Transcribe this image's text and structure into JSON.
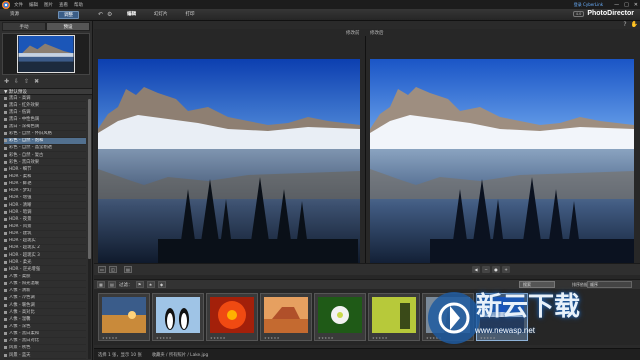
{
  "titlebar": {
    "menus": [
      "文件",
      "编辑",
      "图片",
      "查看",
      "帮助"
    ],
    "account": "登录 CyberLink",
    "controls": [
      "—",
      "□",
      "✕"
    ]
  },
  "modebar": {
    "left_tabs": [
      "资源",
      "调整"
    ],
    "modes": [
      "编辑",
      "幻灯片",
      "打印"
    ],
    "version": "4.0",
    "brand": "PhotoDirector"
  },
  "left_panel": {
    "subtabs": [
      "手动",
      "预设"
    ],
    "section_header": "▼ 默认预设",
    "presets": [
      "黑白 - 高调",
      "黑白 - 红外效果",
      "黑白 - 低调",
      "黑白 - 中性色调",
      "黑白 - 深褐色调",
      "彩色 - 自然 - 怀旧风格",
      "彩色 - 自然 - 饱和",
      "彩色 - 自然 - 晶莹剔透",
      "彩色 - 自然 - 复古",
      "彩色 - 黑白效果",
      "HDR - 细节",
      "HDR - 柔和",
      "HDR - 鲜艳",
      "HDR - 梦幻",
      "HDR - 增强",
      "HDR - 清晰",
      "HDR - 暗调",
      "HDR - 夜景",
      "HDR - 风景",
      "HDR - 建筑",
      "HDR - 超现实",
      "HDR - 超现实 2",
      "HDR - 超现实 3",
      "HDR - 柔光",
      "HDR - 逆光增强",
      "人像 - 柔肤",
      "人像 - 阳光温暖",
      "人像 - 清新",
      "人像 - 冷色调",
      "人像 - 暖色调",
      "人像 - 高对比",
      "人像 - 温馨",
      "人像 - 深色",
      "人像 - 黑白柔和",
      "人像 - 黑白对比",
      "风景 - 秋色",
      "风景 - 蓝天"
    ],
    "selected_index": 6
  },
  "main": {
    "before_label": "修改前",
    "after_label": "修改后"
  },
  "filmstrip_bar": {
    "filter_label": "过滤：",
    "search_placeholder": "搜索",
    "sort_label": "排序依据：",
    "sort_value": "顺序"
  },
  "status": {
    "selection": "选择 1 张，显示 10 张",
    "path": "收藏夹 / 所有照片 / Lake.jpg"
  },
  "watermark": {
    "text": "新云下载",
    "url": "www.newasp.net"
  },
  "colors": {
    "accent": "#3a5d87",
    "selection": "#52708f"
  }
}
